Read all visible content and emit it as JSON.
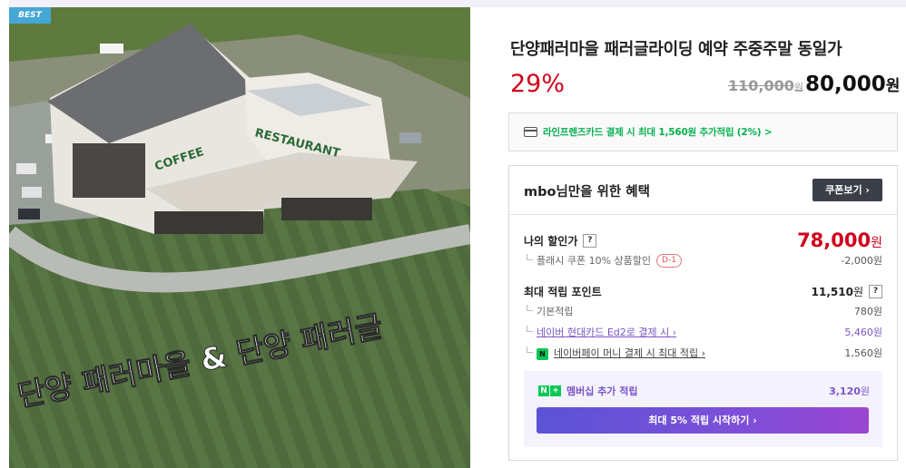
{
  "product": {
    "badge": "BEST",
    "title": "단양패러마을 패러글라이딩 예약 주중주말 동일가",
    "discount_rate": "29%",
    "original_price": "110,000",
    "original_unit": "원",
    "sale_price": "80,000",
    "sale_unit": "원",
    "image": {
      "overlay_text": "단양 패러마을 & 단양 패러글",
      "sign_restaurant": "RESTAURANT",
      "sign_coffee": "COFFEE"
    }
  },
  "card_banner": {
    "icon": "credit-card-icon",
    "text": "라인프렌즈카드 결제 시 최대 1,560원 추가적립 (2%) >"
  },
  "benefits": {
    "title": "mbo님만을 위한 혜택",
    "coupon_button": "쿠폰보기 ›",
    "my_price": {
      "label": "나의 할인가",
      "help": "?",
      "value": "78,000",
      "unit": "원"
    },
    "coupon_row": {
      "label": "플래시 쿠폰 10% 상품할인",
      "d_badge": "D-1",
      "value": "-2,000원"
    },
    "points": {
      "label": "최대 적립 포인트",
      "value": "11,510",
      "unit": "원",
      "help": "?"
    },
    "point_items": [
      {
        "label": "기본적립",
        "value": "780원"
      },
      {
        "label": "네이버 현대카드 Ed2로 결제 시 ›",
        "value": "5,460원"
      },
      {
        "label": "네이버페이 머니 결제 시 최대 적립 ›",
        "value": "1,560원",
        "icon": "N"
      }
    ],
    "membership": {
      "icon_n": "N",
      "icon_plus": "+",
      "label": "멤버십 추가 적립",
      "value": "3,120",
      "unit": "원",
      "cta": "최대 5% 적립 시작하기 ›"
    }
  },
  "colors": {
    "discount_red": "#d0021b",
    "naver_green": "#06c755",
    "membership_purple": "#7a56c7",
    "badge_blue": "#45a7d4"
  }
}
